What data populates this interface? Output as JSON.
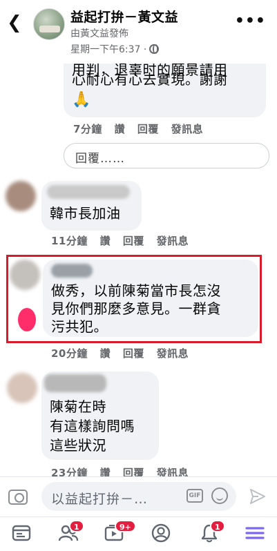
{
  "header": {
    "title": "益起打拚－黃文益",
    "byline": "由黃文益發佈",
    "timestamp": "星期一下午6:37 ·"
  },
  "comments": [
    {
      "partial_text_top": "用判，退辜时的願景請用",
      "text": "心耐心有心去實現。謝謝",
      "emoji": "🙏",
      "time": "7分鐘",
      "like": "讚",
      "reply": "回覆",
      "message": "發訊息"
    },
    {
      "text": "韓市長加油",
      "time": "11分鐘",
      "like": "讚",
      "reply": "回覆",
      "message": "發訊息"
    },
    {
      "lines": [
        "做秀，以前陳菊當市長怎沒",
        "見你們那麼多意見。一群貪",
        "污共犯。"
      ],
      "time": "20分鐘",
      "like": "讚",
      "reply": "回覆",
      "message": "發訊息"
    },
    {
      "lines": [
        "陳菊在時",
        "有這樣詢問嗎",
        "這些狀況"
      ],
      "time": "23分鐘",
      "like": "讚",
      "reply": "回覆",
      "message": "發訊息"
    }
  ],
  "reply_input": {
    "placeholder": "回覆……"
  },
  "composer": {
    "placeholder": "以益起打拚－…",
    "gif_label": "GIF"
  },
  "tabbar": {
    "badges": {
      "friends": "1",
      "watch": "9+",
      "notifications": "1"
    }
  },
  "colors": {
    "accent": "#7b68ee",
    "badge": "#e41e3f",
    "highlight": "#d81b2a"
  }
}
